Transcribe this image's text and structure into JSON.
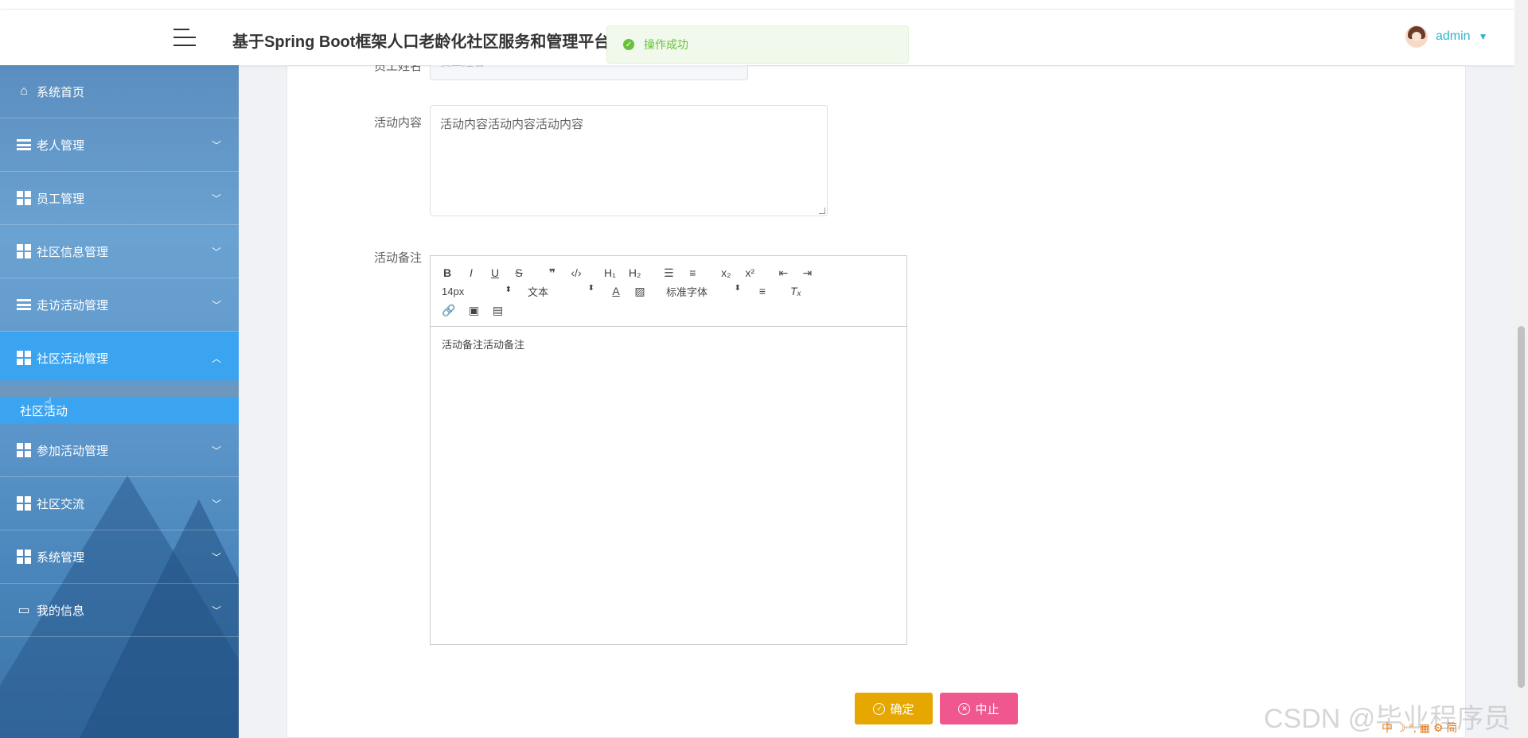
{
  "header": {
    "title": "基于Spring Boot框架人口老龄化社区服务和管理平台",
    "username": "admin",
    "caret": "▼"
  },
  "toast": {
    "message": "操作成功",
    "icon": "✓"
  },
  "sidebar": {
    "items": [
      {
        "label": "系统首页",
        "icon": "home-icon"
      },
      {
        "label": "老人管理",
        "icon": "list-icon",
        "arrow": "﹀"
      },
      {
        "label": "员工管理",
        "icon": "grid-icon",
        "arrow": "﹀"
      },
      {
        "label": "社区信息管理",
        "icon": "grid-icon",
        "arrow": "﹀"
      },
      {
        "label": "走访活动管理",
        "icon": "list-icon",
        "arrow": "﹀"
      },
      {
        "label": "社区活动管理",
        "icon": "grid-icon",
        "arrow": "︿"
      },
      {
        "label": "参加活动管理",
        "icon": "grid-icon",
        "arrow": "﹀"
      },
      {
        "label": "社区交流",
        "icon": "grid-icon",
        "arrow": "﹀"
      },
      {
        "label": "系统管理",
        "icon": "grid-icon",
        "arrow": "﹀"
      },
      {
        "label": "我的信息",
        "icon": "wallet-icon",
        "arrow": "﹀"
      }
    ],
    "submenu": {
      "label": "社区活动"
    }
  },
  "form": {
    "employee_name_label": "员工姓名",
    "employee_name_placeholder": "员工姓名",
    "content_label": "活动内容",
    "content_value": "活动内容活动内容活动内容",
    "remark_label": "活动备注",
    "remark_value": "活动备注活动备注"
  },
  "editor_toolbar": {
    "font_size": "14px",
    "paragraph": "文本",
    "font_family": "标准字体"
  },
  "buttons": {
    "confirm": "确定",
    "cancel": "中止"
  },
  "watermark": "CSDN @毕业程序员",
  "ime": "中 ☽ °, ▦ ⚙ 简"
}
